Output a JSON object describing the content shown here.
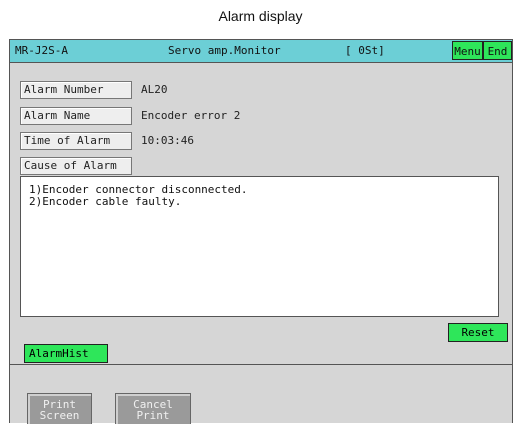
{
  "caption": "Alarm display",
  "titlebar": {
    "model": "MR-J2S-A",
    "title": "Servo amp.Monitor",
    "station": "[ 0St]",
    "menu_label": "Menu",
    "end_label": "End"
  },
  "fields": {
    "alarm_number": {
      "label": "Alarm Number",
      "value": "AL20"
    },
    "alarm_name": {
      "label": "Alarm Name",
      "value": "Encoder error 2"
    },
    "time_of_alarm": {
      "label": "Time of Alarm",
      "value": "10:03:46"
    },
    "cause_of_alarm": {
      "label": "Cause of Alarm"
    }
  },
  "cause_lines": [
    "1)Encoder connector disconnected.",
    "2)Encoder cable faulty."
  ],
  "buttons": {
    "reset": "Reset",
    "alarm_hist": "AlarmHist",
    "print_screen_line1": "Print",
    "print_screen_line2": "Screen",
    "cancel_print_line1": "Cancel",
    "cancel_print_line2": "Print"
  },
  "colors": {
    "titlebar": "#6ccfd6",
    "button_green": "#2ee65a",
    "screen_bg": "#d6d6d6",
    "disabled_button": "#9a9a9a"
  }
}
